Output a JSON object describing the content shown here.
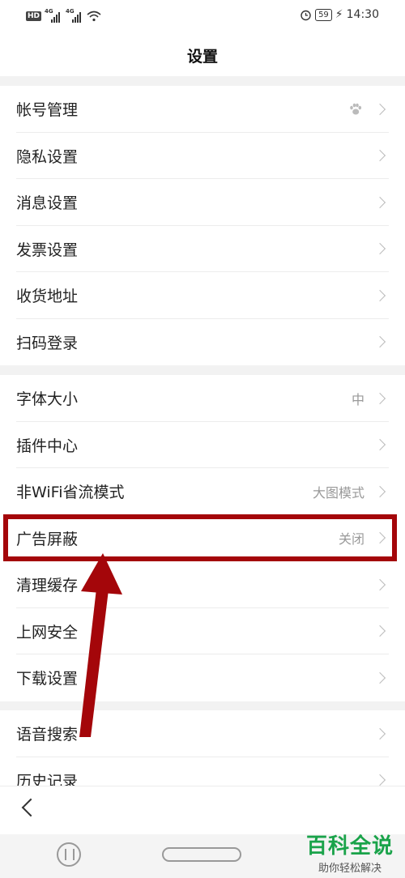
{
  "status": {
    "network": "4G",
    "battery": "59",
    "time": "14:30"
  },
  "header": {
    "title": "设置"
  },
  "groups": [
    {
      "items": [
        {
          "label": "帐号管理",
          "value": ""
        },
        {
          "label": "隐私设置",
          "value": ""
        },
        {
          "label": "消息设置",
          "value": ""
        },
        {
          "label": "发票设置",
          "value": ""
        },
        {
          "label": "收货地址",
          "value": ""
        },
        {
          "label": "扫码登录",
          "value": ""
        }
      ]
    },
    {
      "items": [
        {
          "label": "字体大小",
          "value": "中"
        },
        {
          "label": "插件中心",
          "value": ""
        },
        {
          "label": "非WiFi省流模式",
          "value": "大图模式"
        },
        {
          "label": "广告屏蔽",
          "value": "关闭"
        },
        {
          "label": "清理缓存",
          "value": ""
        },
        {
          "label": "上网安全",
          "value": ""
        },
        {
          "label": "下载设置",
          "value": ""
        }
      ]
    },
    {
      "items": [
        {
          "label": "语音搜索",
          "value": ""
        },
        {
          "label": "历史记录",
          "value": ""
        }
      ]
    }
  ],
  "annotation": {
    "color": "#a4060a"
  },
  "watermark": {
    "title": "百科全说",
    "subtitle": "助你轻松解决"
  }
}
